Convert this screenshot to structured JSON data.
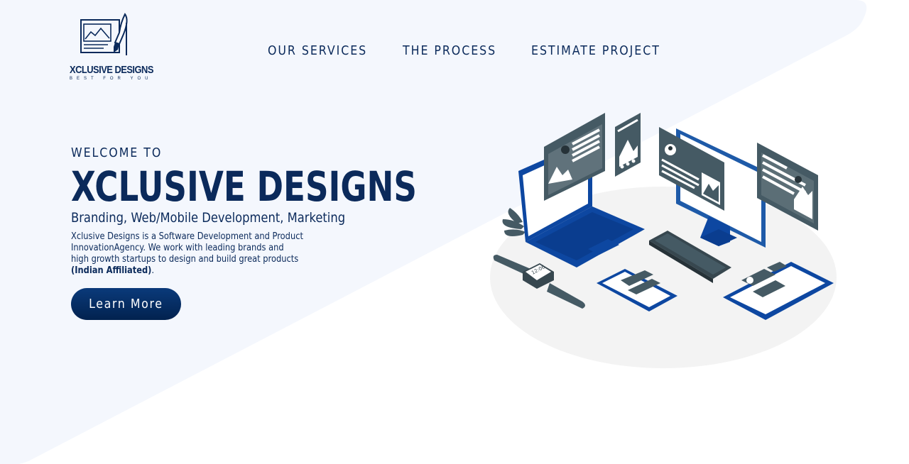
{
  "brand": {
    "name": "XCLUSIVE DESIGNS",
    "tagline": "BEST FOR YOU"
  },
  "nav": {
    "items": [
      {
        "label": "OUR SERVICES"
      },
      {
        "label": "THE PROCESS"
      },
      {
        "label": "ESTIMATE PROJECT"
      }
    ]
  },
  "hero": {
    "welcome": "WELCOME TO",
    "title": "XCLUSIVE DESIGNS",
    "subtitle": "Branding, Web/Mobile Development, Marketing",
    "description_lines": [
      "Xclusive Designs is a Software Development and Product",
      "InnovationAgency. We work with leading brands and",
      "high growth startups to design and build great products"
    ],
    "affiliation": "(Indian Affiliated)",
    "affiliation_suffix": ".",
    "cta_label": "Learn More"
  },
  "illustration": {
    "watch_time": "12:06"
  },
  "colors": {
    "brand_navy": "#0b2a5b",
    "hero_bg": "#f4f7fd",
    "device_blue": "#0d47a1",
    "device_gray": "#455a64",
    "ground": "#f3f3f3"
  }
}
